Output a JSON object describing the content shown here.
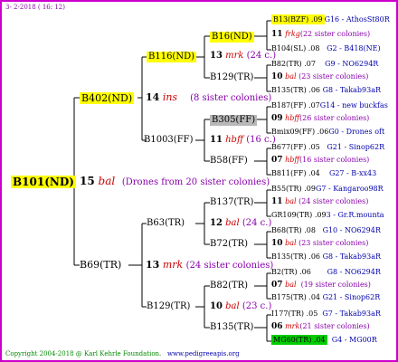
{
  "header": {
    "date": "3- 2-2018 ( 16: 12)"
  },
  "footer": {
    "copyright": "Copyright 2004-2018 @ Karl Kehrle Foundation.",
    "site": "www.pedigreeapis.org"
  },
  "colors": {
    "frame": "#cc00cc",
    "highlight": "#ffff00",
    "grey": "#b8b8b8",
    "green": "#00cc00",
    "red": "#cc0000",
    "purple": "#8800aa",
    "blue": "#0000aa"
  },
  "root": {
    "id": "B101(ND)",
    "year": "15",
    "breed": "bal",
    "note": "(Drones from 20 sister colonies)"
  },
  "gen1": [
    {
      "id": "B402(ND)",
      "year": "14",
      "breed": "ins",
      "note": "(8 sister colonies)"
    },
    {
      "id": "B69(TR)",
      "year": "13",
      "breed": "mrk",
      "note": "(24 sister colonies)"
    }
  ],
  "gen2": [
    {
      "id": "B116(ND)",
      "year": "13",
      "breed": "mrk",
      "note": "(24 c.)"
    },
    {
      "id": "B1003(FF)",
      "year": "11",
      "breed": "hbff",
      "note": "(16 c.)"
    },
    {
      "id": "B63(TR)",
      "year": "12",
      "breed": "bal",
      "note": "(24 c.)"
    },
    {
      "id": "B129(TR)",
      "year": "10",
      "breed": "bal",
      "note": "(23 c.)"
    }
  ],
  "gen3": [
    "B16(ND)",
    "B129(TR)",
    "B305(FF)",
    "B58(FF)",
    "B137(TR)",
    "B72(TR)",
    "B82(TR)",
    "B135(TR)"
  ],
  "gen4": [
    {
      "sire": "B13(BZF) .09",
      "sire_ref": "G16 - AthosSt80R",
      "year": "11",
      "breed": "frkg",
      "note": "(22 sister colonies)",
      "dam": "B104(SL) .08",
      "dam_ref": "G2 - B418(NE)"
    },
    {
      "sire": "B82(TR) .07",
      "sire_ref": "G9 - NO6294R",
      "year": "10",
      "breed": "bal",
      "note": "(23 sister colonies)",
      "dam": "B135(TR) .06",
      "dam_ref": "G8 - Takab93aR"
    },
    {
      "sire": "B187(FF) .07",
      "sire_ref": "G14 - new buckfas",
      "year": "09",
      "breed": "hbff",
      "note": "(26 sister colonies)",
      "dam": "Bmix09(FF) .06",
      "dam_ref": "G0 - Drones oft"
    },
    {
      "sire": "B677(FF) .05",
      "sire_ref": "G21 - Sinop62R",
      "year": "07",
      "breed": "hbff",
      "note": "(16 sister colonies)",
      "dam": "B811(FF) .04",
      "dam_ref": "G27 - B-xx43"
    },
    {
      "sire": "B55(TR) .09",
      "sire_ref": "G7 - Kangaroo98R",
      "year": "11",
      "breed": "bal",
      "note": "(24 sister colonies)",
      "dam": "GR109(TR) .09",
      "dam_ref": "3 - Gr.R.mounta"
    },
    {
      "sire": "B68(TR) .08",
      "sire_ref": "G10 - NO6294R",
      "year": "10",
      "breed": "bal",
      "note": "(23 sister colonies)",
      "dam": "B135(TR) .06",
      "dam_ref": "G8 - Takab93aR"
    },
    {
      "sire": "B2(TR) .06",
      "sire_ref": "G8 - NO6294R",
      "year": "07",
      "breed": "bal",
      "note": "(19 sister colonies)",
      "dam": "B175(TR) .04",
      "dam_ref": "G21 - Sinop62R"
    },
    {
      "sire": "I177(TR) .05",
      "sire_ref": "G7 - Takab93aR",
      "year": "06",
      "breed": "mrk",
      "note": "(21 sister colonies)",
      "dam": "MG60(TR) .04",
      "dam_ref": "G4 - MG00R"
    }
  ]
}
